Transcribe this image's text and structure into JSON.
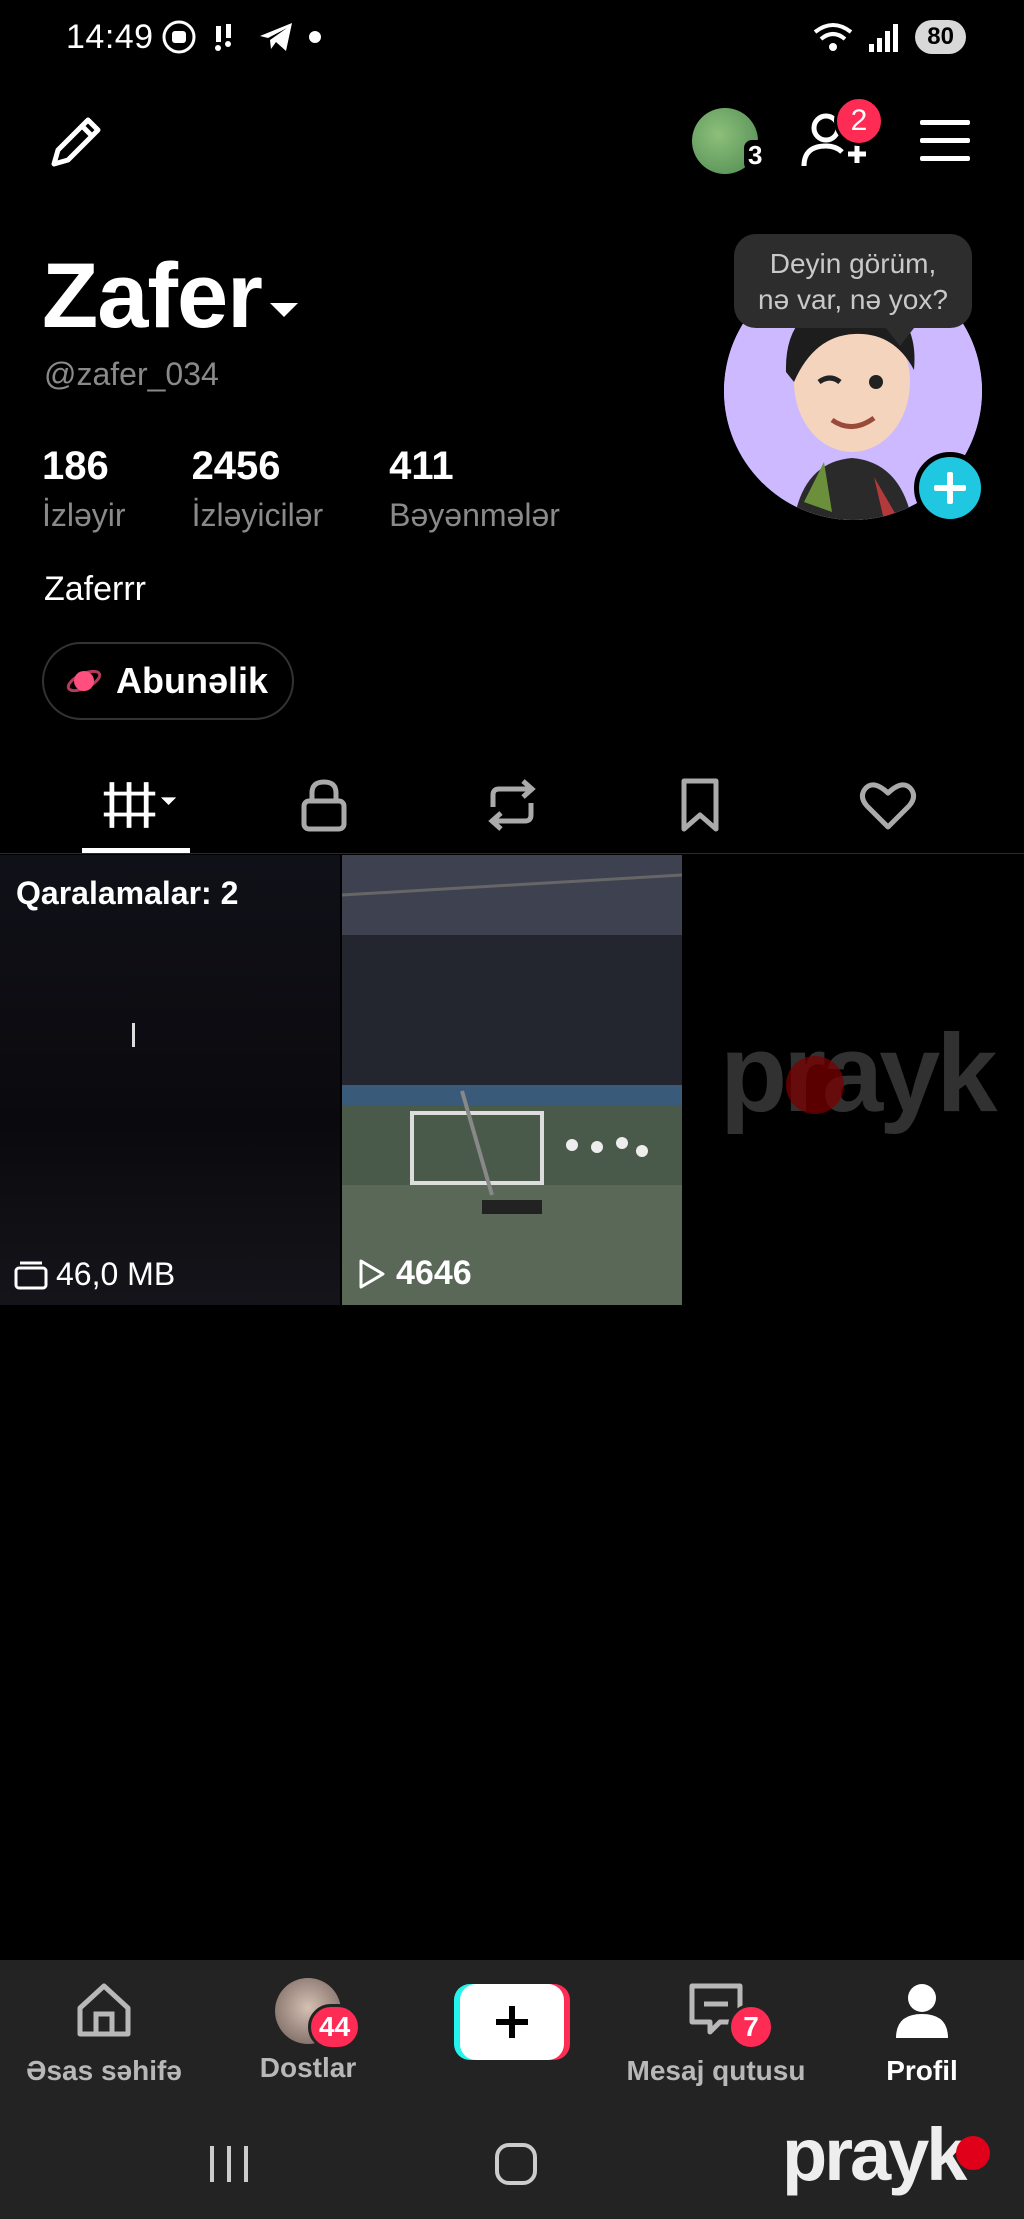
{
  "status_bar": {
    "time": "14:49",
    "battery": "80"
  },
  "top_bar": {
    "avatar_count": "3",
    "friend_requests_badge": "2"
  },
  "profile": {
    "name": "Zafer",
    "username": "@zafer_034",
    "stats": [
      {
        "value": "186",
        "label": "İzləyir"
      },
      {
        "value": "2456",
        "label": "İzləyicilər"
      },
      {
        "value": "411",
        "label": "Bəyənmələr"
      }
    ],
    "bio": "Zaferrr",
    "subscription_label": "Abunəlik",
    "bubble_line1": "Deyin görüm,",
    "bubble_line2": "nə var, nə yox?"
  },
  "tabs": [
    "videos",
    "private",
    "reposts",
    "saved",
    "liked"
  ],
  "grid": {
    "draft_title": "Qaralamalar: 2",
    "draft_size": "46,0 MB",
    "video_views": "4646"
  },
  "bottom_nav": {
    "home": "Əsas səhifə",
    "friends": "Dostlar",
    "friends_badge": "44",
    "inbox": "Mesaj qutusu",
    "inbox_badge": "7",
    "profile": "Profil"
  },
  "brand_text": "prayk"
}
